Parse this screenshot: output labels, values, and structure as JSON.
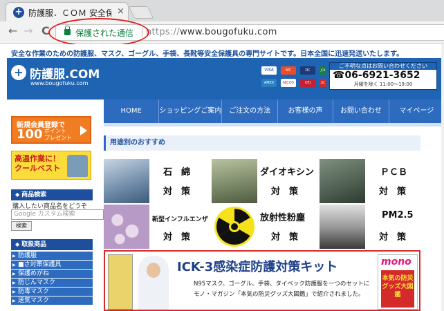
{
  "browser": {
    "tab_title": "防護服．ＣＯＭ 安全保護",
    "tab_close": "×",
    "secure_label": "保護された通信",
    "url_scheme": "https://",
    "url_host": "www.bougofuku.com",
    "back": "←",
    "forward": "→",
    "reload": "C"
  },
  "page": {
    "tagline": "安全な作業のための防護服、マスク、ゴーグル、手袋、長靴等安全保護具の専門サイトです。日本全国に迅速発送いたします。",
    "logo_text": "防護服.COM",
    "logo_url": "www.bougofuku.com",
    "payment_cards": [
      "VISA",
      "MC",
      "DC",
      "JCB",
      "AMEX",
      "NICOS",
      "UFJ",
      "DC"
    ],
    "contact": {
      "head": "ご不明な点はお問い合わせください",
      "phone": "☎06-6921-3652",
      "hours": "月曜を除く 11:00～19:00"
    },
    "nav": [
      "HOME",
      "ショッピングご案内",
      "ご注文の方法",
      "お客様の声",
      "お問い合わせ",
      "マイページ"
    ],
    "member_banner": {
      "line1": "新規会員登録で",
      "number": "100",
      "points": "ポイント",
      "present": "プレゼント"
    },
    "cool_banner": {
      "line1": "高温作業に！",
      "line2": "クールベスト"
    },
    "search": {
      "heading": "商品検索",
      "caption": "購入したい商品名をどうぞ",
      "placeholder": "Google カスタム検索",
      "button": "検索"
    },
    "categories": {
      "heading": "取扱商品",
      "items": [
        "防護服",
        "■さ対策保護具",
        "保護めがね",
        "防じんマスク",
        "防毒マスク",
        "送気マスク"
      ]
    },
    "section_title": "用途別のおすすめ",
    "usecases": [
      {
        "title": "石　綿",
        "sub": "対　策"
      },
      {
        "title": "ダイオキシン",
        "sub": "対　策"
      },
      {
        "title": "ＰＣＢ",
        "sub": "対　策"
      },
      {
        "title": "新型インフルエンザ",
        "sub": "対　策"
      },
      {
        "title": "放射性粉塵",
        "sub": "対　策"
      },
      {
        "title": "PM2.5",
        "sub": "対　策"
      }
    ],
    "ick": {
      "title": "ICK-3感染症防護対策キット",
      "desc1": "N95マスク、ゴーグル、手袋、タイベック防護服を一つのセットに",
      "desc2": "モノ・マガジン「本気の防災グッズ大図鑑」で紹介されました。",
      "mono_logo": "mono",
      "mono_caption": "本気の防災グッズ大図鑑"
    }
  }
}
